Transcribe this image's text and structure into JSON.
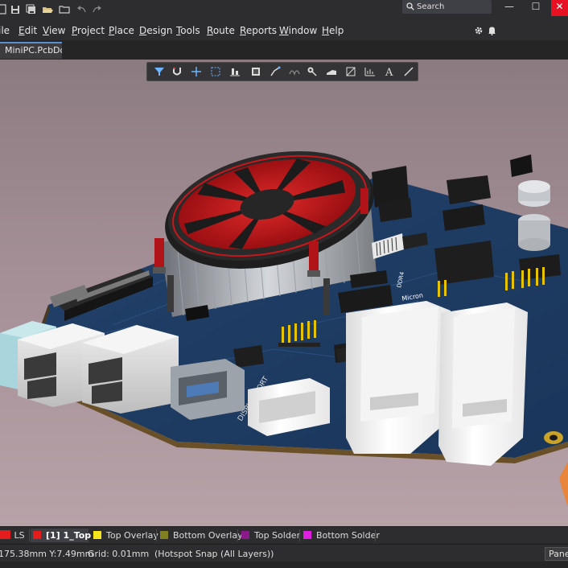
{
  "titlebar": {
    "search_placeholder": "Search",
    "icons": [
      "file-icon",
      "save-icon",
      "save-all-icon",
      "open-folder-icon",
      "folder-icon",
      "undo-icon",
      "redo-icon",
      "search-icon"
    ],
    "window_buttons": {
      "minimize": "—",
      "maximize": "☐",
      "close": "✕"
    }
  },
  "menu": {
    "items": [
      "File",
      "Edit",
      "View",
      "Project",
      "Place",
      "Design",
      "Tools",
      "Route",
      "Reports",
      "Window",
      "Help"
    ],
    "visible_items": [
      "ile",
      "Edit",
      "View",
      "Project",
      "Place",
      "Design",
      "Tools",
      "Route",
      "Reports",
      "Window",
      "Help"
    ],
    "underlined": [
      "",
      "E",
      "V",
      "P",
      "P",
      "D",
      "T",
      "R",
      "R",
      "W",
      "H"
    ],
    "rest": [
      "ile",
      "dit",
      "iew",
      "roject",
      "lace",
      "esign",
      "ools",
      "oute",
      "eports",
      "indow",
      "elp"
    ],
    "right_icons": [
      "gear-icon",
      "bell-icon"
    ]
  },
  "document": {
    "tab_label": "MiniPC.PcbDoc"
  },
  "board_labels": {
    "dsi": "DISPLAY PORT",
    "micron": "Micron",
    "ddr": "DDR4",
    "fan_brand": ""
  },
  "layers": {
    "ls_label": "LS",
    "tabs": [
      {
        "label": "[1] 1_Top",
        "color": "#e51c1c",
        "active": true
      },
      {
        "label": "Top Overlay",
        "color": "#f7e51c",
        "active": false
      },
      {
        "label": "Bottom Overlay",
        "color": "#808020",
        "active": false
      },
      {
        "label": "Top Solder",
        "color": "#8a1a8a",
        "active": false
      },
      {
        "label": "Bottom Solder",
        "color": "#e01ee0",
        "active": false
      }
    ]
  },
  "status": {
    "coords": "175.38mm Y:7.49mm",
    "grid": "Grid: 0.01mm",
    "snap": "(Hotspot Snap (All Layers))",
    "panels": "Panels"
  },
  "colors": {
    "accent": "#5b8fd1",
    "board": "#1f3d66",
    "fan_red": "#c8161b"
  }
}
